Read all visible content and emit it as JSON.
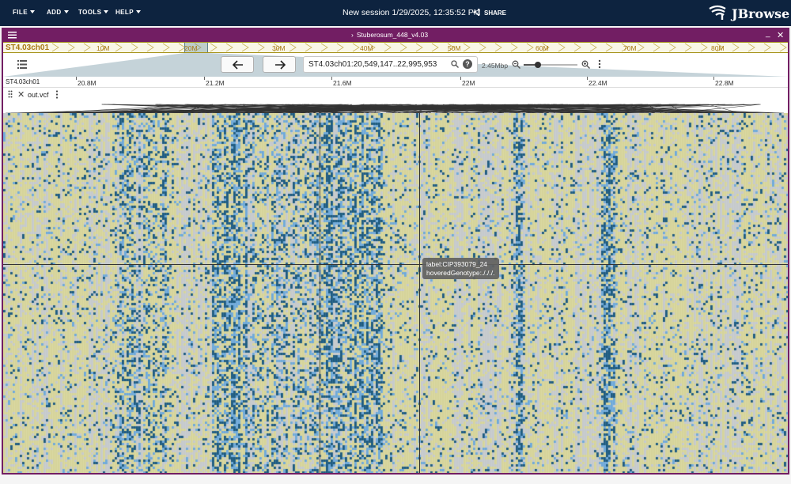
{
  "appbar": {
    "menus": [
      {
        "label": "FILE"
      },
      {
        "label": "ADD"
      },
      {
        "label": "TOOLS"
      },
      {
        "label": "HELP"
      }
    ],
    "session_title": "New session 1/29/2025, 12:35:52 PM",
    "share_label": "SHARE",
    "logo_text": "JBrowse"
  },
  "view": {
    "assembly": "Stuberosum_448_v4.03",
    "overview_chrom": "ST4.03ch01",
    "overview_ticks": [
      "10M",
      "20M",
      "30M",
      "40M",
      "50M",
      "60M",
      "70M",
      "80M"
    ],
    "location": "ST4.03ch01:20,549,147..22,995,953",
    "zoom_label": "2.45Mbp",
    "ruler_chrom": "ST4.03ch01",
    "ruler_ticks": [
      "20.8M",
      "21.2M",
      "21.6M",
      "22M",
      "22.4M",
      "22.8M"
    ]
  },
  "track": {
    "name": "out.vcf"
  },
  "tooltip": {
    "line1": "label:CIP393079_24",
    "line2": "hoveredGenotype:./././."
  },
  "colors": {
    "header": "#0d233f",
    "view_border": "#721e63",
    "ref": "#d6d49a",
    "missing": "#c5c9cc",
    "het": "#6fa9d9",
    "hom_alt": "#1e5b80"
  }
}
